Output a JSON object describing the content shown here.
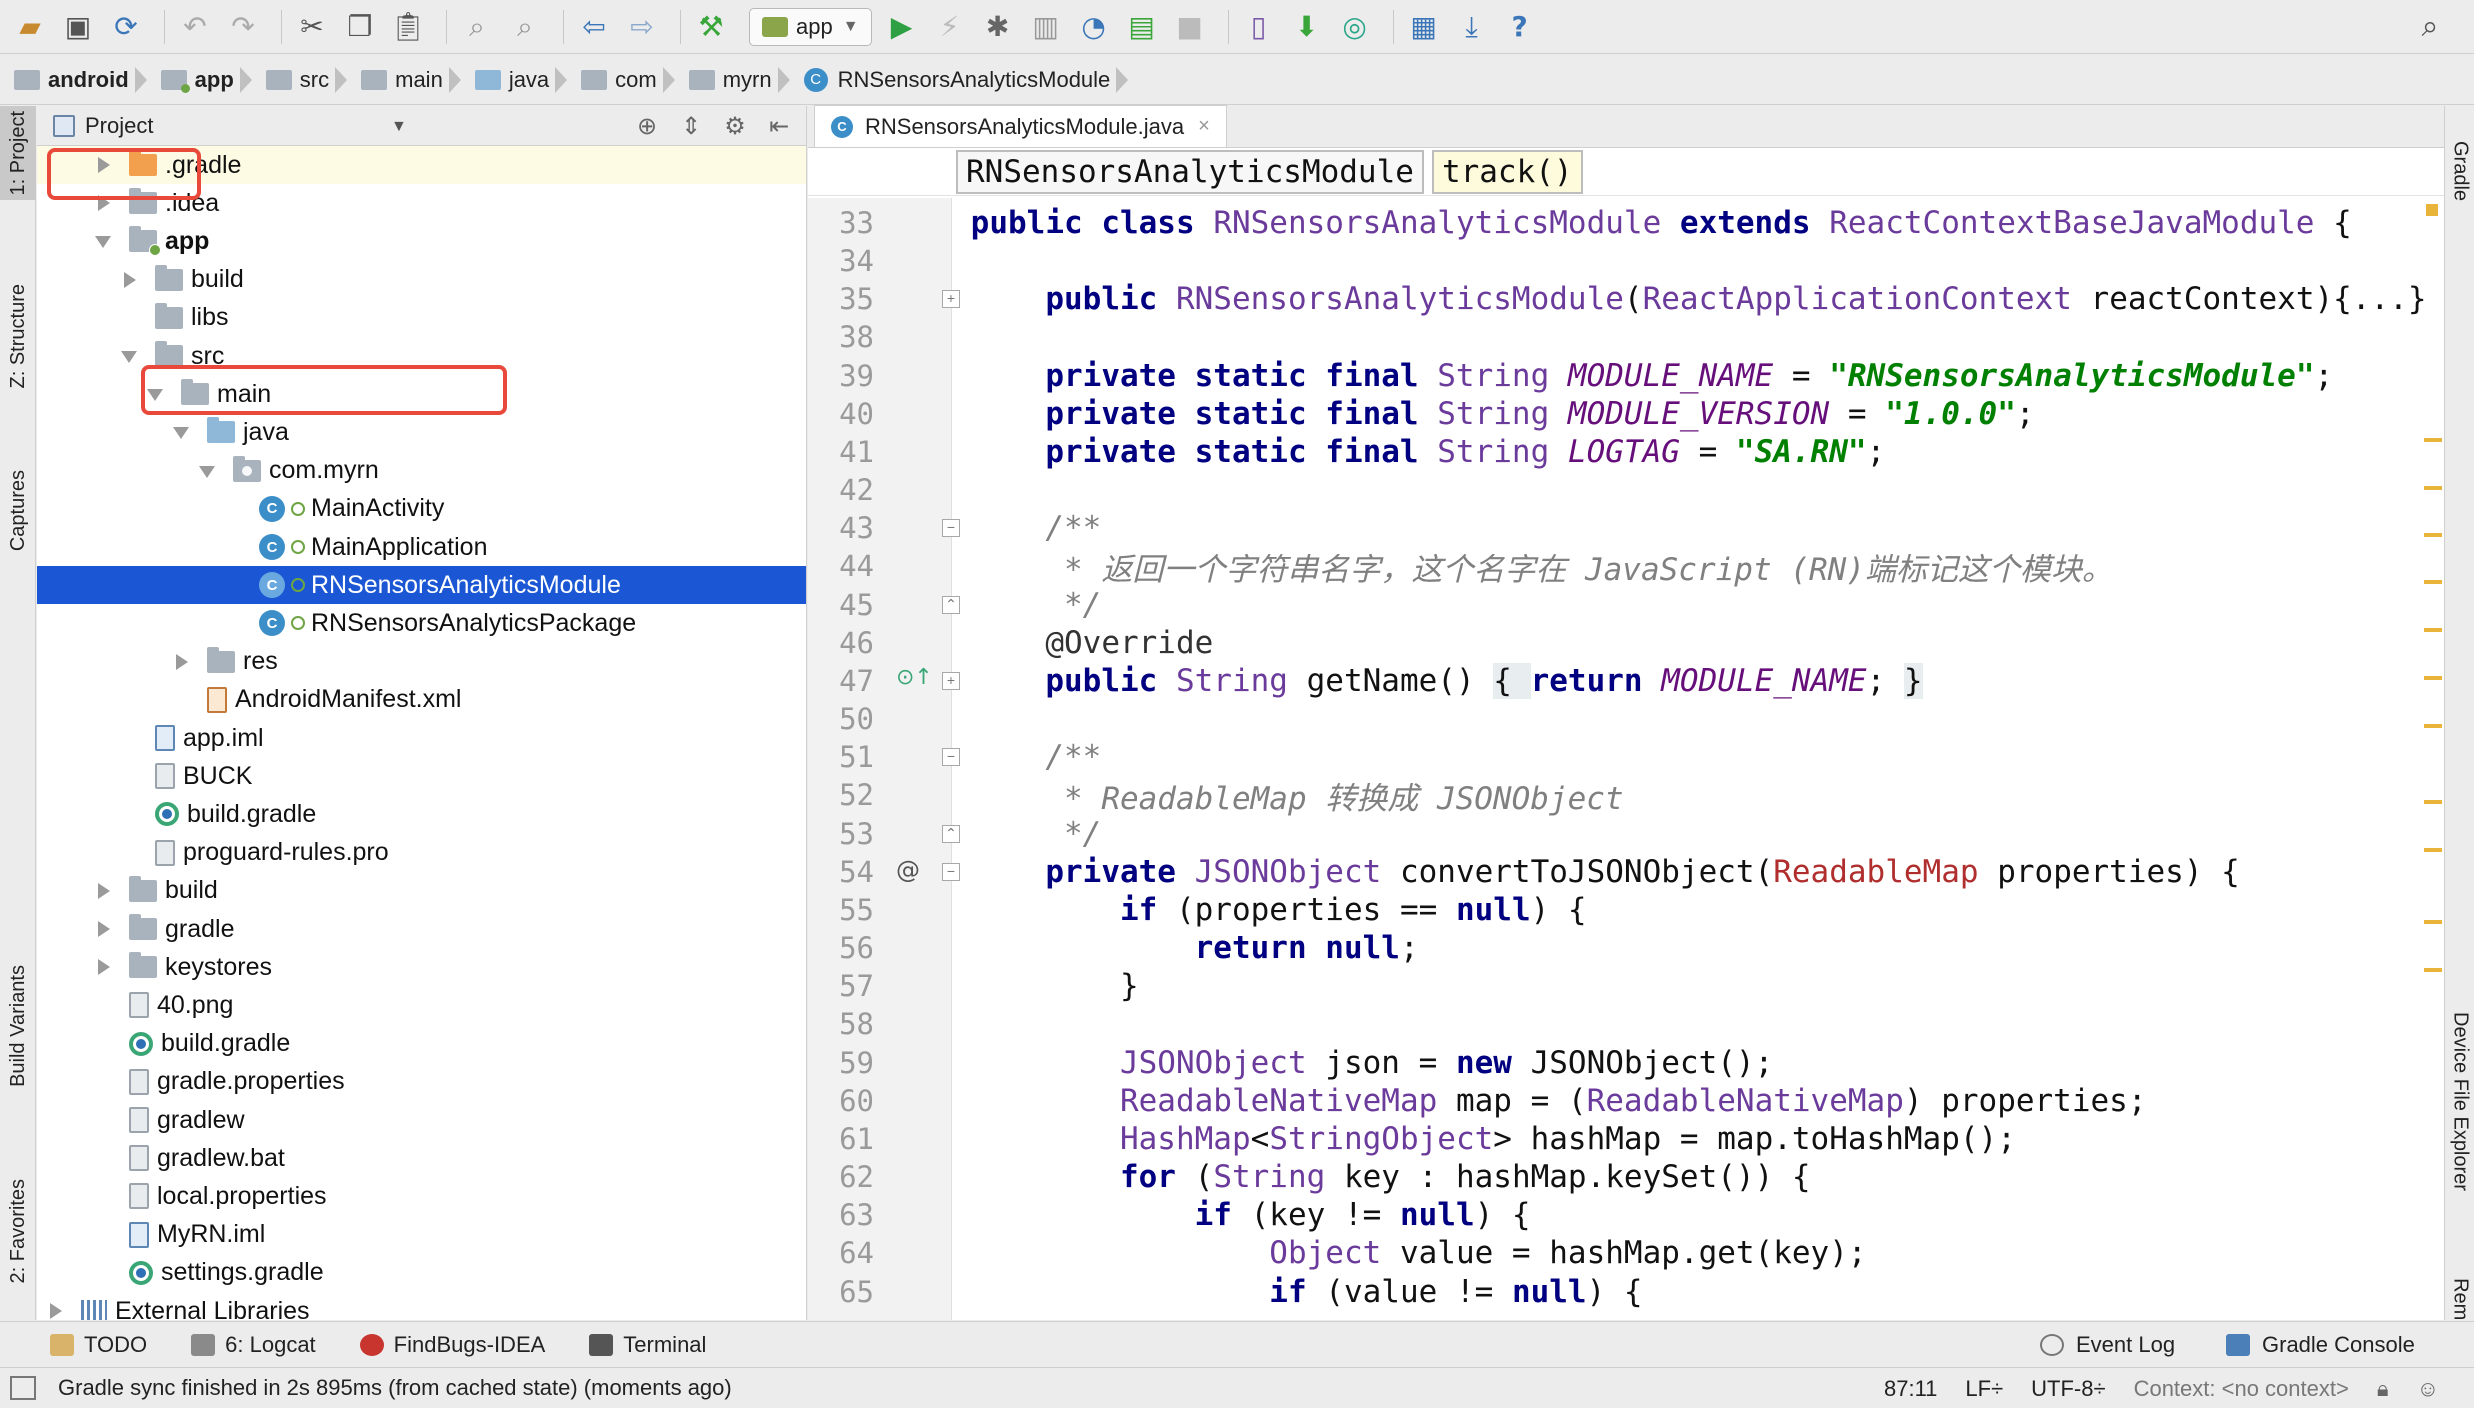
{
  "toolbar": {
    "icons": [
      "open-icon",
      "save-icon",
      "sync-icon",
      "undo-icon",
      "redo-icon",
      "cut-icon",
      "copy-icon",
      "paste-icon",
      "find-icon",
      "replace-icon",
      "back-icon",
      "forward-icon",
      "build-icon",
      "run-icon",
      "apply-changes-icon",
      "debug-icon",
      "profile-icon",
      "attach-icon",
      "coverage-icon",
      "stop-icon",
      "avd-icon",
      "sdk-icon",
      "layout-inspector-icon",
      "project-structure-icon",
      "gradle-sync-icon",
      "help-icon",
      "search-icon"
    ],
    "run_config": "app"
  },
  "breadcrumb": [
    {
      "label": "android",
      "kind": "project"
    },
    {
      "label": "app",
      "kind": "module"
    },
    {
      "label": "src",
      "kind": "folder"
    },
    {
      "label": "main",
      "kind": "folder"
    },
    {
      "label": "java",
      "kind": "source"
    },
    {
      "label": "com",
      "kind": "folder"
    },
    {
      "label": "myrn",
      "kind": "folder"
    },
    {
      "label": "RNSensorsAnalyticsModule",
      "kind": "class"
    }
  ],
  "left_tabs": [
    "1: Project",
    "Z: Structure",
    "Captures",
    "Build Variants",
    "2: Favorites"
  ],
  "right_tabs": [
    "Gradle",
    "Device File Explorer",
    "TV Remote"
  ],
  "project_panel": {
    "title": "Project"
  },
  "tree": [
    {
      "label": ".gradle",
      "depth": 1,
      "arrow": "right",
      "icon": "folder-orange",
      "hl": "yellow"
    },
    {
      "label": ".idea",
      "depth": 1,
      "arrow": "right",
      "icon": "folder"
    },
    {
      "label": "app",
      "depth": 1,
      "arrow": "down",
      "icon": "folder-module",
      "bold": true
    },
    {
      "label": "build",
      "depth": 2,
      "arrow": "right",
      "icon": "folder"
    },
    {
      "label": "libs",
      "depth": 2,
      "arrow": "none",
      "icon": "folder"
    },
    {
      "label": "src",
      "depth": 2,
      "arrow": "down",
      "icon": "folder"
    },
    {
      "label": "main",
      "depth": 3,
      "arrow": "down",
      "icon": "folder"
    },
    {
      "label": "java",
      "depth": 4,
      "arrow": "down",
      "icon": "folder-blue"
    },
    {
      "label": "com.myrn",
      "depth": 5,
      "arrow": "down",
      "icon": "folder-pkg"
    },
    {
      "label": "MainActivity",
      "depth": 6,
      "arrow": "none",
      "icon": "class"
    },
    {
      "label": "MainApplication",
      "depth": 6,
      "arrow": "none",
      "icon": "class"
    },
    {
      "label": "RNSensorsAnalyticsModule",
      "depth": 6,
      "arrow": "none",
      "icon": "class",
      "selected": true
    },
    {
      "label": "RNSensorsAnalyticsPackage",
      "depth": 6,
      "arrow": "none",
      "icon": "class"
    },
    {
      "label": "res",
      "depth": 4,
      "arrow": "right",
      "icon": "folder"
    },
    {
      "label": "AndroidManifest.xml",
      "depth": 4,
      "arrow": "none",
      "icon": "file-xml"
    },
    {
      "label": "app.iml",
      "depth": 2,
      "arrow": "none",
      "icon": "file-iml"
    },
    {
      "label": "BUCK",
      "depth": 2,
      "arrow": "none",
      "icon": "file"
    },
    {
      "label": "build.gradle",
      "depth": 2,
      "arrow": "none",
      "icon": "gradle"
    },
    {
      "label": "proguard-rules.pro",
      "depth": 2,
      "arrow": "none",
      "icon": "file"
    },
    {
      "label": "build",
      "depth": 1,
      "arrow": "right",
      "icon": "folder"
    },
    {
      "label": "gradle",
      "depth": 1,
      "arrow": "right",
      "icon": "folder"
    },
    {
      "label": "keystores",
      "depth": 1,
      "arrow": "right",
      "icon": "folder"
    },
    {
      "label": "40.png",
      "depth": 1,
      "arrow": "none",
      "icon": "file"
    },
    {
      "label": "build.gradle",
      "depth": 1,
      "arrow": "none",
      "icon": "gradle"
    },
    {
      "label": "gradle.properties",
      "depth": 1,
      "arrow": "none",
      "icon": "file"
    },
    {
      "label": "gradlew",
      "depth": 1,
      "arrow": "none",
      "icon": "file"
    },
    {
      "label": "gradlew.bat",
      "depth": 1,
      "arrow": "none",
      "icon": "file"
    },
    {
      "label": "local.properties",
      "depth": 1,
      "arrow": "none",
      "icon": "file"
    },
    {
      "label": "MyRN.iml",
      "depth": 1,
      "arrow": "none",
      "icon": "file-iml"
    },
    {
      "label": "settings.gradle",
      "depth": 1,
      "arrow": "none",
      "icon": "gradle"
    },
    {
      "label": "External Libraries",
      "depth": 0,
      "arrow": "right",
      "icon": "lib"
    }
  ],
  "editor": {
    "tab_label": "RNSensorsAnalyticsModule.java",
    "crumbs": [
      "RNSensorsAnalyticsModule",
      "track()"
    ],
    "lines": [
      {
        "n": "33",
        "t": [
          [
            "kw",
            "public class "
          ],
          [
            "ty",
            "RNSensorsAnalyticsModule "
          ],
          [
            "kw",
            "extends "
          ],
          [
            "ty",
            "ReactContextBaseJavaModule "
          ],
          [
            "",
            "{"
          ]
        ]
      },
      {
        "n": "34",
        "t": []
      },
      {
        "n": "35",
        "fold": "+",
        "t": [
          [
            "",
            "    "
          ],
          [
            "kw",
            "public "
          ],
          [
            "ty",
            "RNSensorsAnalyticsModule"
          ],
          [
            "",
            "("
          ],
          [
            "ty",
            "ReactApplicationContext "
          ],
          [
            "",
            "reactContext"
          ],
          [
            "",
            "){...}"
          ]
        ]
      },
      {
        "n": "38",
        "t": []
      },
      {
        "n": "39",
        "t": [
          [
            "",
            "    "
          ],
          [
            "kw",
            "private static final "
          ],
          [
            "ty",
            "String "
          ],
          [
            "cst",
            "MODULE_NAME"
          ],
          [
            "",
            " = "
          ],
          [
            "str",
            "\"RNSensorsAnalyticsModule\""
          ],
          [
            "",
            ";"
          ]
        ]
      },
      {
        "n": "40",
        "t": [
          [
            "",
            "    "
          ],
          [
            "kw",
            "private static final "
          ],
          [
            "ty",
            "String "
          ],
          [
            "cst",
            "MODULE_VERSION"
          ],
          [
            "",
            " = "
          ],
          [
            "str",
            "\"1.0.0\""
          ],
          [
            "",
            ";"
          ]
        ]
      },
      {
        "n": "41",
        "t": [
          [
            "",
            "    "
          ],
          [
            "kw",
            "private static final "
          ],
          [
            "ty",
            "String "
          ],
          [
            "cst",
            "LOGTAG"
          ],
          [
            "",
            " = "
          ],
          [
            "str",
            "\"SA.RN\""
          ],
          [
            "",
            ";"
          ]
        ]
      },
      {
        "n": "42",
        "t": []
      },
      {
        "n": "43",
        "fold": "-",
        "t": [
          [
            "cmt",
            "    /**"
          ]
        ]
      },
      {
        "n": "44",
        "t": [
          [
            "cmt",
            "     * 返回一个字符串名字，这个名字在 JavaScript (RN)端标记这个模块。"
          ]
        ]
      },
      {
        "n": "45",
        "fold": "^",
        "t": [
          [
            "cmt",
            "     */"
          ]
        ]
      },
      {
        "n": "46",
        "t": [
          [
            "an",
            "    @Override"
          ]
        ]
      },
      {
        "n": "47",
        "fold": "+",
        "mark": "impl",
        "t": [
          [
            "",
            "    "
          ],
          [
            "kw",
            "public "
          ],
          [
            "ty",
            "String "
          ],
          [
            "",
            "getName() "
          ],
          [
            "brace",
            "{ "
          ],
          [
            "kw",
            "return "
          ],
          [
            "cst",
            "MODULE_NAME"
          ],
          [
            "",
            "; "
          ],
          [
            "brace",
            "}"
          ]
        ]
      },
      {
        "n": "50",
        "t": []
      },
      {
        "n": "51",
        "fold": "-",
        "t": [
          [
            "cmt",
            "    /**"
          ]
        ]
      },
      {
        "n": "52",
        "t": [
          [
            "cmt",
            "     * ReadableMap 转换成 JSONObject"
          ]
        ]
      },
      {
        "n": "53",
        "fold": "^",
        "t": [
          [
            "cmt",
            "     */"
          ]
        ]
      },
      {
        "n": "54",
        "fold": "-",
        "mark": "at",
        "t": [
          [
            "",
            "    "
          ],
          [
            "kw",
            "private "
          ],
          [
            "ty",
            "JSONObject "
          ],
          [
            "",
            "convertToJSONObject("
          ],
          [
            "ty2",
            "ReadableMap "
          ],
          [
            "",
            "properties) {"
          ]
        ]
      },
      {
        "n": "55",
        "t": [
          [
            "",
            "        "
          ],
          [
            "kw",
            "if "
          ],
          [
            "",
            "(properties == "
          ],
          [
            "kw",
            "null"
          ],
          [
            "",
            ") {"
          ]
        ]
      },
      {
        "n": "56",
        "t": [
          [
            "",
            "            "
          ],
          [
            "kw",
            "return null"
          ],
          [
            "",
            ";"
          ]
        ]
      },
      {
        "n": "57",
        "t": [
          [
            "",
            "        }"
          ]
        ]
      },
      {
        "n": "58",
        "t": []
      },
      {
        "n": "59",
        "t": [
          [
            "",
            "        "
          ],
          [
            "ty",
            "JSONObject "
          ],
          [
            "",
            "json = "
          ],
          [
            "kw",
            "new "
          ],
          [
            "",
            "JSONObject();"
          ]
        ]
      },
      {
        "n": "60",
        "t": [
          [
            "",
            "        "
          ],
          [
            "ty",
            "ReadableNativeMap "
          ],
          [
            "",
            "map = ("
          ],
          [
            "ty",
            "ReadableNativeMap"
          ],
          [
            "",
            ") properties;"
          ]
        ]
      },
      {
        "n": "61",
        "t": [
          [
            "",
            "        "
          ],
          [
            "ty",
            "HashMap"
          ],
          [
            "",
            "<"
          ],
          [
            "ty",
            "String"
          ],
          [
            ", "
          ],
          [
            "ty",
            "Object"
          ],
          [
            "",
            "> hashMap = map.toHashMap();"
          ]
        ]
      },
      {
        "n": "62",
        "t": [
          [
            "",
            "        "
          ],
          [
            "kw",
            "for "
          ],
          [
            "",
            "("
          ],
          [
            "ty",
            "String "
          ],
          [
            "",
            "key : hashMap.keySet()) {"
          ]
        ]
      },
      {
        "n": "63",
        "t": [
          [
            "",
            "            "
          ],
          [
            "kw",
            "if "
          ],
          [
            "",
            "(key != "
          ],
          [
            "kw",
            "null"
          ],
          [
            "",
            ") {"
          ]
        ]
      },
      {
        "n": "64",
        "t": [
          [
            "",
            "                "
          ],
          [
            "ty",
            "Object "
          ],
          [
            "",
            "value = hashMap.get(key);"
          ]
        ]
      },
      {
        "n": "65",
        "t": [
          [
            "",
            "                "
          ],
          [
            "kw",
            "if "
          ],
          [
            "",
            "(value != "
          ],
          [
            "kw",
            "null"
          ],
          [
            "",
            ") {"
          ]
        ]
      }
    ]
  },
  "bottom_tools": {
    "todo": "TODO",
    "logcat": "6: Logcat",
    "findbugs": "FindBugs-IDEA",
    "terminal": "Terminal",
    "event_log": "Event Log",
    "gradle_console": "Gradle Console"
  },
  "status": {
    "message": "Gradle sync finished in 2s 895ms (from cached state) (moments ago)",
    "position": "87:11",
    "line_sep": "LF÷",
    "encoding": "UTF-8÷",
    "context": "Context: <no context>"
  }
}
